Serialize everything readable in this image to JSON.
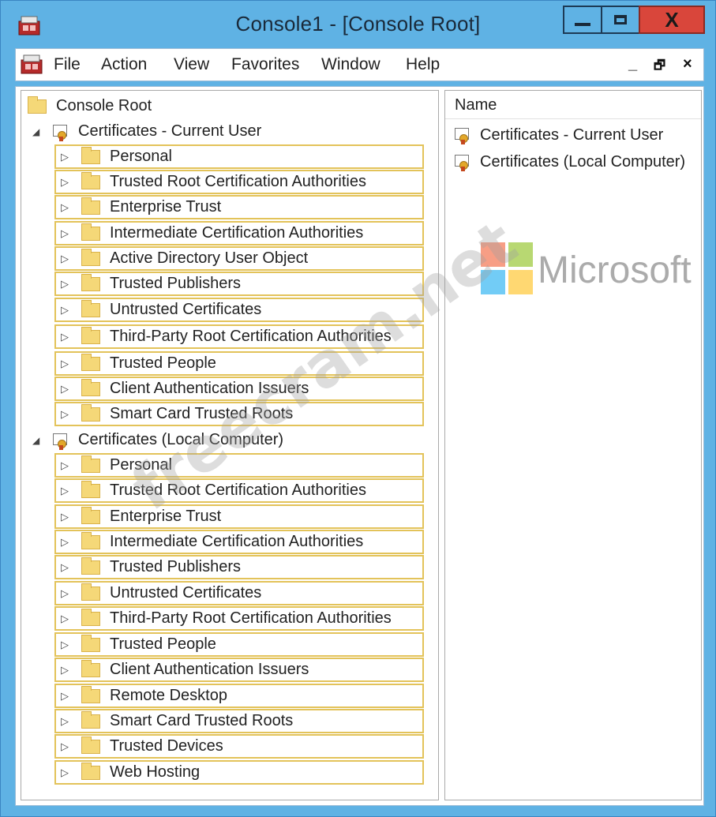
{
  "window": {
    "title": "Console1 - [Console Root]",
    "close_glyph": "X"
  },
  "menu": {
    "items": [
      "File",
      "Action",
      "View",
      "Favorites",
      "Window",
      "Help"
    ],
    "mdi_minimize": "_",
    "mdi_restore": "🗗",
    "mdi_close": "×"
  },
  "tree": {
    "root_label": "Console Root",
    "groups": [
      {
        "label": "Certificates - Current User",
        "children": [
          "Personal",
          "Trusted Root Certification Authorities",
          "Enterprise Trust",
          "Intermediate Certification Authorities",
          "Active Directory User Object",
          "Trusted Publishers",
          "Untrusted Certificates",
          "Third-Party Root Certification Authorities",
          "Trusted People",
          "Client Authentication Issuers",
          "Smart Card Trusted Roots"
        ]
      },
      {
        "label": "Certificates (Local Computer)",
        "children": [
          "Personal",
          "Trusted Root Certification Authorities",
          "Enterprise Trust",
          "Intermediate Certification Authorities",
          "Trusted Publishers",
          "Untrusted Certificates",
          "Third-Party Root Certification Authorities",
          "Trusted People",
          "Client Authentication Issuers",
          "Remote Desktop",
          "Smart Card Trusted Roots",
          "Trusted Devices",
          "Web Hosting"
        ]
      }
    ]
  },
  "list": {
    "column_header": "Name",
    "items": [
      "Certificates - Current User",
      "Certificates (Local Computer)"
    ]
  },
  "watermark": {
    "brand_text": "Microsoft",
    "site_text": "freecram.net"
  },
  "colors": {
    "titlebar": "#5fb2e4",
    "close_button": "#d9463b",
    "highlight_border": "#e3c35a",
    "folder": "#f5d878"
  }
}
